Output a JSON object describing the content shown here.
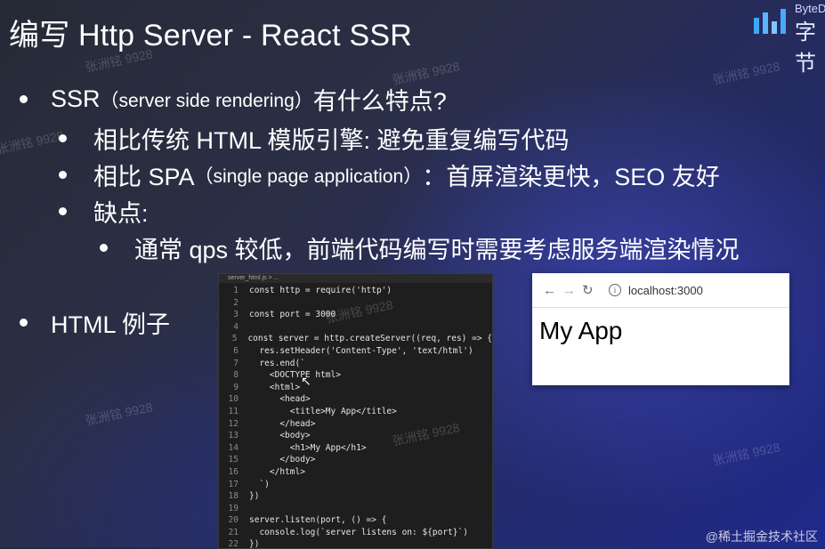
{
  "slide": {
    "title": "编写 Http Server - React SSR",
    "logo_top": "ByteD",
    "logo_bottom": "字节",
    "watermark": "张洲铭 9928",
    "footer": "@稀土掘金技术社区"
  },
  "bullets": {
    "ssr_main": "SSR",
    "ssr_paren": "（server side rendering）",
    "ssr_rest": "有什么特点?",
    "sub1": "相比传统 HTML 模版引擎: 避免重复编写代码",
    "sub2_a": "相比 SPA",
    "sub2_paren": "（single page application）",
    "sub2_b": "：首屏渲染更快，SEO 友好",
    "sub3": "缺点:",
    "sub3_1": "通常 qps 较低，前端代码编写时需要考虑服务端渲染情况",
    "html_example": "HTML 例子"
  },
  "code": {
    "file_tab": "server_html.js > ...",
    "lines": [
      {
        "n": "1",
        "t": "const http = require('http')"
      },
      {
        "n": "2",
        "t": ""
      },
      {
        "n": "3",
        "t": "const port = 3000"
      },
      {
        "n": "4",
        "t": ""
      },
      {
        "n": "5",
        "t": "const server = http.createServer((req, res) => {"
      },
      {
        "n": "6",
        "t": "  res.setHeader('Content-Type', 'text/html')"
      },
      {
        "n": "7",
        "t": "  res.end(`"
      },
      {
        "n": "8",
        "t": "    <DOCTYPE html>"
      },
      {
        "n": "9",
        "t": "    <html>"
      },
      {
        "n": "10",
        "t": "      <head>"
      },
      {
        "n": "11",
        "t": "        <title>My App</title>"
      },
      {
        "n": "12",
        "t": "      </head>"
      },
      {
        "n": "13",
        "t": "      <body>"
      },
      {
        "n": "14",
        "t": "        <h1>My App</h1>"
      },
      {
        "n": "15",
        "t": "      </body>"
      },
      {
        "n": "16",
        "t": "    </html>"
      },
      {
        "n": "17",
        "t": "  `)"
      },
      {
        "n": "18",
        "t": "})"
      },
      {
        "n": "19",
        "t": ""
      },
      {
        "n": "20",
        "t": "server.listen(port, () => {"
      },
      {
        "n": "21",
        "t": "  console.log(`server listens on: ${port}`)"
      },
      {
        "n": "22",
        "t": "})"
      }
    ]
  },
  "browser": {
    "back_icon": "arrow-left-icon",
    "forward_icon": "arrow-right-icon",
    "reload_icon": "reload-icon",
    "url": "localhost:3000",
    "page_heading": "My App"
  },
  "colors": {
    "accent": "#1f2a8c",
    "code_bg": "#1e1e1e"
  }
}
